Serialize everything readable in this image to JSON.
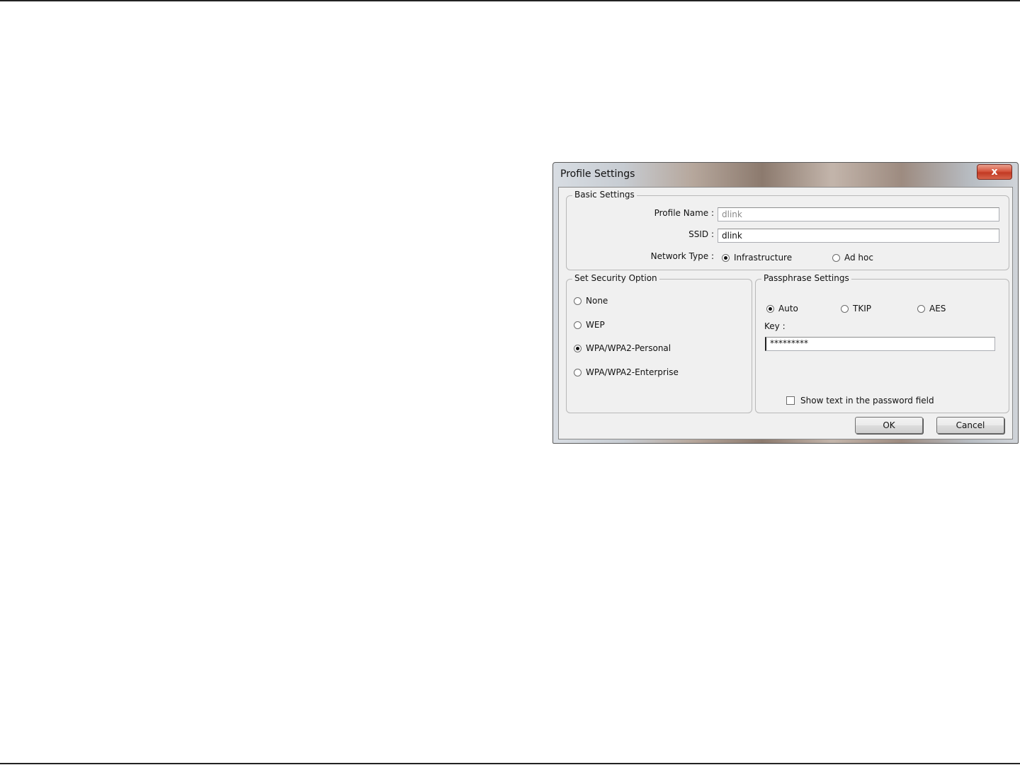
{
  "window": {
    "title": "Profile Settings",
    "close_label": "x"
  },
  "basic_settings": {
    "title": "Basic Settings",
    "profile_name_label": "Profile Name :",
    "profile_name_value": "dlink",
    "ssid_label": "SSID :",
    "ssid_value": "dlink",
    "network_type_label": "Network Type :",
    "network_type_options": [
      "Infrastructure",
      "Ad hoc"
    ],
    "network_type_selected": "Infrastructure"
  },
  "security": {
    "title": "Set Security Option",
    "options": [
      "None",
      "WEP",
      "WPA/WPA2-Personal",
      "WPA/WPA2-Enterprise"
    ],
    "selected": "WPA/WPA2-Personal"
  },
  "passphrase": {
    "title": "Passphrase Settings",
    "cipher_options": [
      "Auto",
      "TKIP",
      "AES"
    ],
    "cipher_selected": "Auto",
    "key_label": "Key :",
    "key_value": "*********",
    "show_text_label": "Show text in the password field",
    "show_text_checked": false
  },
  "buttons": {
    "ok_label": "OK",
    "cancel_label": "Cancel"
  }
}
